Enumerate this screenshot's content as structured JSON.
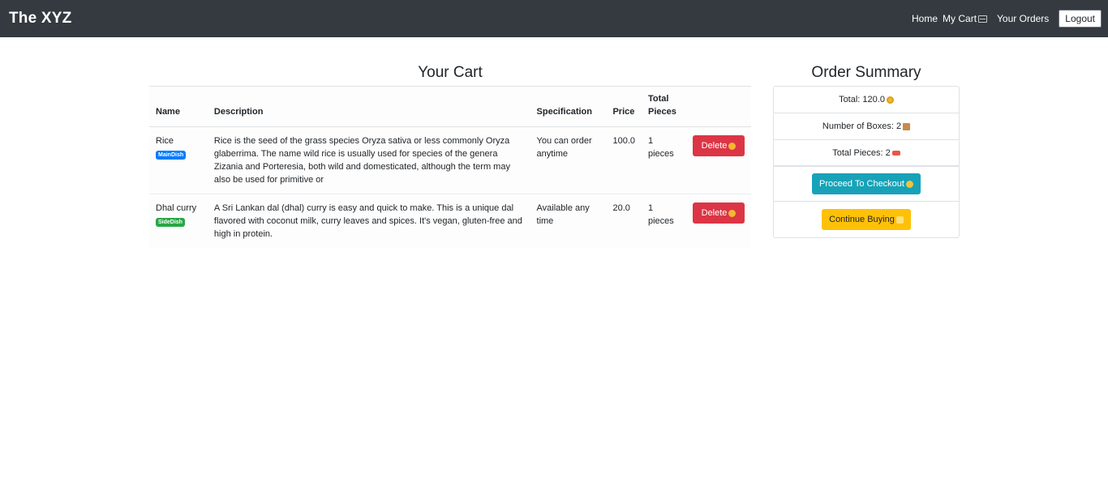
{
  "navbar": {
    "brand": "The XYZ",
    "links": {
      "home": "Home",
      "my_cart": "My Cart",
      "your_orders": "Your Orders"
    },
    "logout_label": "Logout"
  },
  "cart": {
    "title": "Your Cart",
    "columns": {
      "name": "Name",
      "description": "Description",
      "specification": "Specification",
      "price": "Price",
      "total_pieces": "Total Pieces"
    },
    "rows": [
      {
        "name": "Rice",
        "badge": "MainDish",
        "description": "Rice is the seed of the grass species Oryza sativa or less commonly Oryza glaberrima. The name wild rice is usually used for species of the genera Zizania and Porteresia, both wild and domesticated, although the term may also be used for primitive or",
        "specification": "You can order anytime",
        "price": "100.0",
        "pieces": "1 pieces",
        "delete_label": "Delete"
      },
      {
        "name": "Dhal curry",
        "badge": "SideDish",
        "description": "A Sri Lankan dal (dhal) curry is easy and quick to make. This is a unique dal flavored with coconut milk, curry leaves and spices. It's vegan, gluten-free and high in protein.",
        "specification": "Available any time",
        "price": "20.0",
        "pieces": "1 pieces",
        "delete_label": "Delete"
      }
    ]
  },
  "summary": {
    "title": "Order Summary",
    "total": "Total: 120.0",
    "boxes": "Number of Boxes: 2",
    "pieces": "Total Pieces: 2",
    "checkout_label": "Proceed To Checkout",
    "continue_label": "Continue Buying"
  },
  "colors": {
    "navbar": "#343a40",
    "danger": "#dc3545",
    "info": "#17a2b8",
    "warning": "#ffc107",
    "badge_main": "#007bff",
    "badge_side": "#28a745"
  },
  "icons": {
    "cart": "shopping-cart-icon",
    "delete": "sad-face-icon",
    "total": "money-face-icon",
    "boxes": "package-icon",
    "pieces": "sushi-icon",
    "checkout": "handshake-icon",
    "continue": "hand-icon"
  }
}
